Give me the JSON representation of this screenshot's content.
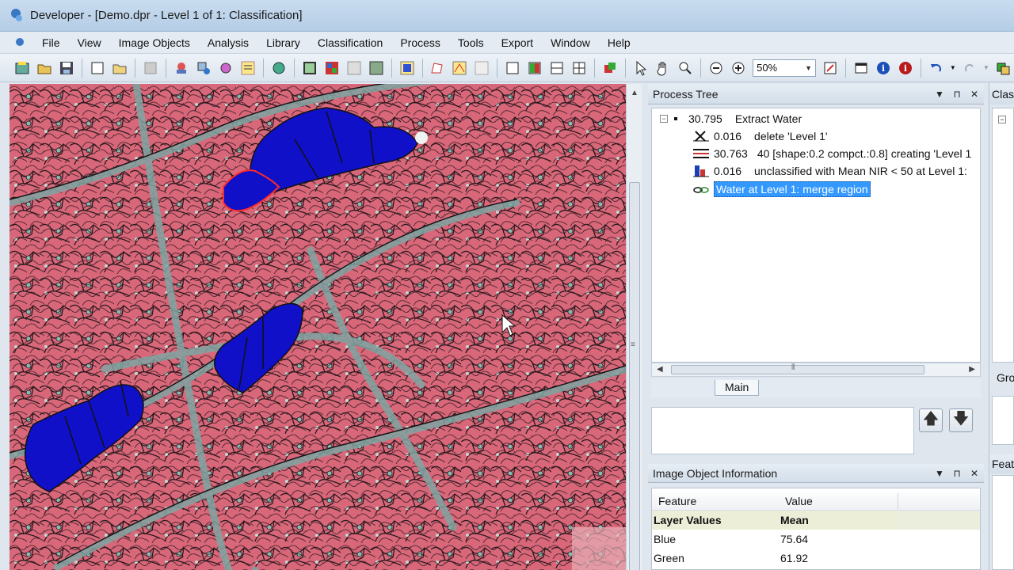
{
  "window": {
    "title": "Developer - [Demo.dpr - Level 1 of 1: Classification]"
  },
  "menu": [
    "File",
    "View",
    "Image Objects",
    "Analysis",
    "Library",
    "Classification",
    "Process",
    "Tools",
    "Export",
    "Window",
    "Help"
  ],
  "toolbar": {
    "zoom_value": "50%"
  },
  "process_tree": {
    "title": "Process Tree",
    "root": {
      "time": "30.795",
      "label": "Extract Water"
    },
    "children": [
      {
        "time": "0.016",
        "label": "delete 'Level 1'"
      },
      {
        "time": "30.763",
        "label": "40 [shape:0.2 compct.:0.8] creating 'Level 1"
      },
      {
        "time": "0.016",
        "label": "unclassified with Mean NIR < 50  at  Level 1:"
      },
      {
        "time": "",
        "label": "Water at  Level 1: merge region"
      }
    ],
    "tab_label": "Main"
  },
  "image_object_info": {
    "title": "Image Object Information",
    "headers": {
      "feature": "Feature",
      "value": "Value"
    },
    "group": {
      "feature": "Layer Values",
      "value": "Mean"
    },
    "rows": [
      {
        "feature": "Blue",
        "value": "75.64"
      },
      {
        "feature": "Green",
        "value": "61.92"
      }
    ]
  },
  "side_panel": {
    "title": "Class",
    "tab": "Gro",
    "title2": "Feat"
  },
  "colors": {
    "water": "#1010c8",
    "vegetation": "#d9677a",
    "road": "#8fb8b4",
    "selection": "#3399ff"
  }
}
